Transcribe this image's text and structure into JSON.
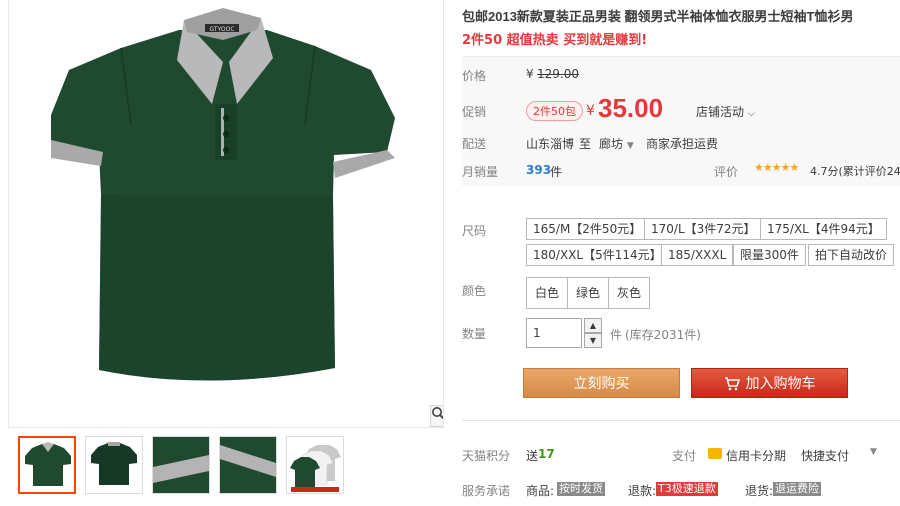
{
  "product": {
    "title": "包邮2013新款夏装正品男装 翻领男式半袖体恤衣服男士短袖T恤衫男",
    "subtitle": "2件50 超值热卖 买到就是赚到!",
    "shirt_color": "#1f4a30",
    "collar_color": "#b4b4b4",
    "collar_label": "GTYOOC"
  },
  "price": {
    "label": "价格",
    "currency": "¥",
    "original": "129.00"
  },
  "promo": {
    "label": "促销",
    "badge": "2件50包",
    "currency": "¥",
    "price": "35.00",
    "store_activity": "店铺活动"
  },
  "delivery": {
    "label": "配送",
    "from": "山东淄博",
    "to_word": "至",
    "to": "廊坊",
    "shipping": "商家承担运费"
  },
  "sales": {
    "label": "月销量",
    "count": "393",
    "unit": "件",
    "rating_label": "评价",
    "stars": "★★★★★",
    "rating_text": "4.7分(累计评价24"
  },
  "size": {
    "label": "尺码",
    "options": [
      "165/M【2件50元】",
      "170/L【3件72元】",
      "175/XL【4件94元】",
      "180/XXL【5件114元】",
      "185/XXXL",
      "限量300件",
      "拍下自动改价"
    ]
  },
  "color": {
    "label": "颜色",
    "options": [
      "白色",
      "绿色",
      "灰色"
    ]
  },
  "quantity": {
    "label": "数量",
    "value": "1",
    "unit": "件",
    "stock": "(库存2031件)"
  },
  "actions": {
    "buy_now": "立刻购买",
    "add_to_cart": "加入购物车"
  },
  "points": {
    "label": "天猫积分",
    "send": "送",
    "value": "17",
    "pay_label": "支付",
    "credit": "信用卡分期",
    "quick": "快捷支付"
  },
  "service": {
    "label": "服务承诺",
    "goods": "商品:",
    "goods_tag": "按时发货",
    "refund": "退款:",
    "refund_tag": "T3极速退款",
    "return": "退货:",
    "return_tag": "退运费险"
  },
  "colors": {
    "accent_red": "#e4393c",
    "buy_orange": "#d68a47",
    "cart_red": "#c8271a"
  }
}
